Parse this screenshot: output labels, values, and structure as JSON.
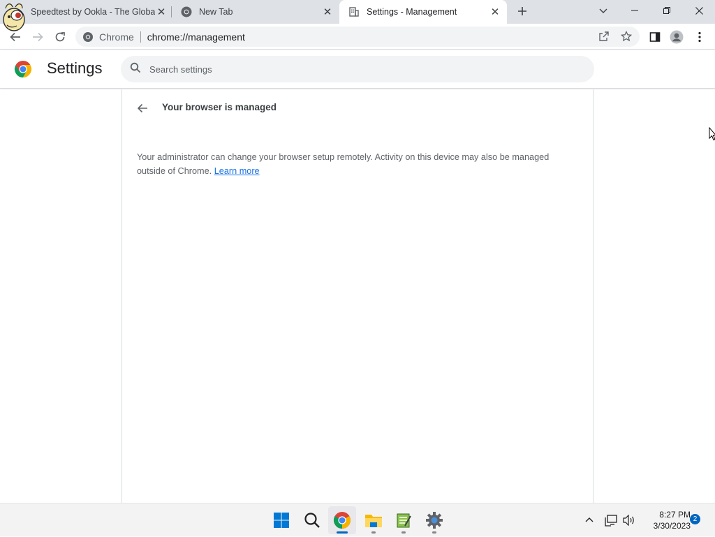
{
  "tabs": [
    {
      "title": "Speedtest by Ookla - The Global Broadband Speed Test",
      "icon": "speedtest-icon"
    },
    {
      "title": "New Tab",
      "icon": "chrome-icon"
    },
    {
      "title": "Settings - Management",
      "icon": "management-icon",
      "active": true
    }
  ],
  "toolbar": {
    "site_chip": "Chrome",
    "url": "chrome://management"
  },
  "settings": {
    "title": "Settings",
    "search_placeholder": "Search settings"
  },
  "page": {
    "heading": "Your browser is managed",
    "body_text": "Your administrator can change your browser setup remotely. Activity on this device may also be managed outside of Chrome.",
    "learn_more": "Learn more"
  },
  "taskbar": {
    "apps": [
      "start-icon",
      "search-icon",
      "chrome-icon",
      "file-explorer-icon",
      "notepad-icon",
      "settings-gear-icon"
    ],
    "active_app": "chrome-icon",
    "time": "8:27 PM",
    "date": "3/30/2023",
    "notification_count": "2"
  },
  "colors": {
    "accent": "#1a73e8",
    "tabstrip": "#dee1e6",
    "taskbar_accent": "#0067c0"
  }
}
